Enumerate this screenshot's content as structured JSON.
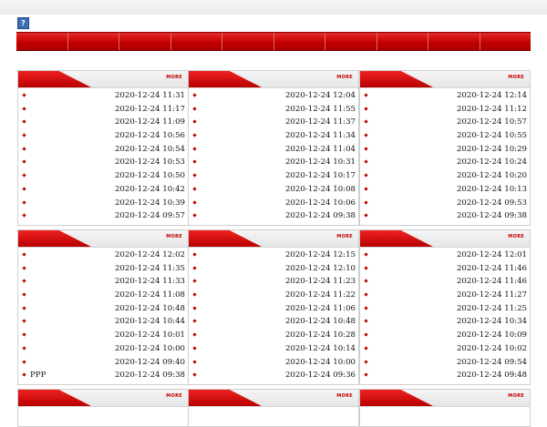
{
  "help_icon_label": "?",
  "more_label": "MORE",
  "nav_items": [
    "",
    "",
    "",
    "",
    "",
    "",
    "",
    "",
    "",
    ""
  ],
  "panels": [
    {
      "rows": [
        {
          "title": "",
          "time": "2020-12-24 11:31"
        },
        {
          "title": "",
          "time": "2020-12-24 11:17"
        },
        {
          "title": "",
          "time": "2020-12-24 11:09"
        },
        {
          "title": "",
          "time": "2020-12-24 10:56"
        },
        {
          "title": "",
          "time": "2020-12-24 10:54"
        },
        {
          "title": "",
          "time": "2020-12-24 10:53"
        },
        {
          "title": "",
          "time": "2020-12-24 10:50"
        },
        {
          "title": "",
          "time": "2020-12-24 10:42"
        },
        {
          "title": "",
          "time": "2020-12-24 10:39"
        },
        {
          "title": "",
          "time": "2020-12-24 09:57"
        }
      ]
    },
    {
      "rows": [
        {
          "title": "",
          "time": "2020-12-24 12:04"
        },
        {
          "title": "",
          "time": "2020-12-24 11:55"
        },
        {
          "title": "",
          "time": "2020-12-24 11:37"
        },
        {
          "title": "",
          "time": "2020-12-24 11:34"
        },
        {
          "title": "",
          "time": "2020-12-24 11:04"
        },
        {
          "title": "",
          "time": "2020-12-24 10:31"
        },
        {
          "title": "",
          "time": "2020-12-24 10:17"
        },
        {
          "title": "",
          "time": "2020-12-24 10:08"
        },
        {
          "title": "",
          "time": "2020-12-24 10:06"
        },
        {
          "title": "",
          "time": "2020-12-24 09:38"
        }
      ]
    },
    {
      "rows": [
        {
          "title": "",
          "time": "2020-12-24 12:14"
        },
        {
          "title": "",
          "time": "2020-12-24 11:12"
        },
        {
          "title": "",
          "time": "2020-12-24 10:57"
        },
        {
          "title": "",
          "time": "2020-12-24 10:55"
        },
        {
          "title": "",
          "time": "2020-12-24 10:29"
        },
        {
          "title": "",
          "time": "2020-12-24 10:24"
        },
        {
          "title": "",
          "time": "2020-12-24 10:20"
        },
        {
          "title": "",
          "time": "2020-12-24 10:13"
        },
        {
          "title": "",
          "time": "2020-12-24 09:53"
        },
        {
          "title": "",
          "time": "2020-12-24 09:38"
        }
      ]
    },
    {
      "rows": [
        {
          "title": "",
          "time": "2020-12-24 12:02"
        },
        {
          "title": "",
          "time": "2020-12-24 11:35"
        },
        {
          "title": "",
          "time": "2020-12-24 11:33"
        },
        {
          "title": "",
          "time": "2020-12-24 11:08"
        },
        {
          "title": "",
          "time": "2020-12-24 10:48"
        },
        {
          "title": "",
          "time": "2020-12-24 10:44"
        },
        {
          "title": "",
          "time": "2020-12-24 10:01"
        },
        {
          "title": "",
          "time": "2020-12-24 10:00"
        },
        {
          "title": "",
          "time": "2020-12-24 09:40"
        },
        {
          "title": "PPP",
          "time": "2020-12-24 09:38"
        }
      ]
    },
    {
      "rows": [
        {
          "title": "",
          "time": "2020-12-24 12:15"
        },
        {
          "title": "",
          "time": "2020-12-24 12:10"
        },
        {
          "title": "",
          "time": "2020-12-24 11:23"
        },
        {
          "title": "",
          "time": "2020-12-24 11:22"
        },
        {
          "title": "",
          "time": "2020-12-24 11:06"
        },
        {
          "title": "",
          "time": "2020-12-24 10:48"
        },
        {
          "title": "",
          "time": "2020-12-24 10:28"
        },
        {
          "title": "",
          "time": "2020-12-24 10:14"
        },
        {
          "title": "",
          "time": "2020-12-24 10:00"
        },
        {
          "title": "",
          "time": "2020-12-24 09:36"
        }
      ]
    },
    {
      "rows": [
        {
          "title": "",
          "time": "2020-12-24 12:01"
        },
        {
          "title": "",
          "time": "2020-12-24 11:46"
        },
        {
          "title": "",
          "time": "2020-12-24 11:46"
        },
        {
          "title": "",
          "time": "2020-12-24 11:27"
        },
        {
          "title": "",
          "time": "2020-12-24 11:25"
        },
        {
          "title": "",
          "time": "2020-12-24 10:34"
        },
        {
          "title": "",
          "time": "2020-12-24 10:09"
        },
        {
          "title": "",
          "time": "2020-12-24 10:02"
        },
        {
          "title": "",
          "time": "2020-12-24 09:54"
        },
        {
          "title": "",
          "time": "2020-12-24 09:48"
        }
      ]
    },
    {
      "rows": []
    },
    {
      "rows": []
    },
    {
      "rows": []
    }
  ]
}
